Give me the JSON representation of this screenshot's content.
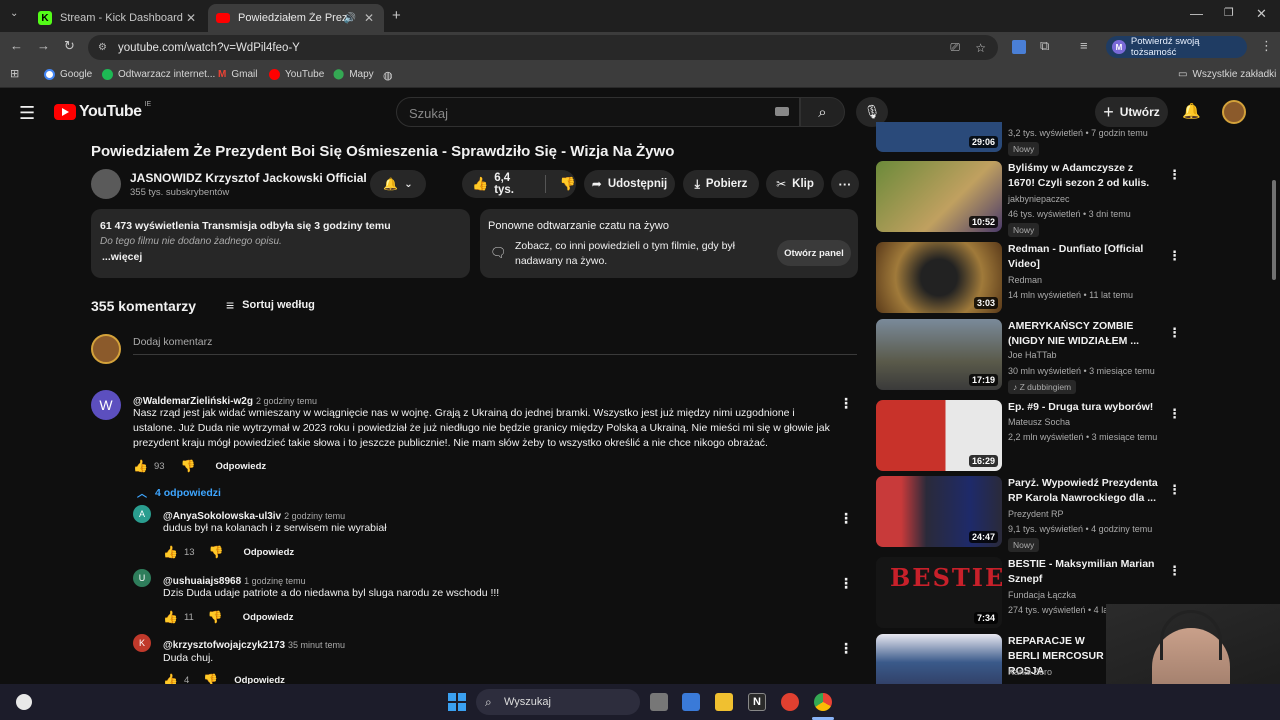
{
  "browser": {
    "tabs": [
      {
        "title": "Stream - Kick Dashboard",
        "favicon": "K"
      },
      {
        "title": "Powiedziałem Że Prezydent",
        "favicon": "yt"
      }
    ],
    "url": "youtube.com/watch?v=WdPil4feo-Y",
    "profile_label": "Potwierdź swoją tożsamość",
    "profile_initial": "M",
    "bookmarks": [
      "Google",
      "Odtwarzacz internet...",
      "Gmail",
      "YouTube",
      "Mapy"
    ],
    "all_bookmarks": "Wszystkie zakładki"
  },
  "youtube": {
    "logo_text": "YouTube",
    "region": "IE",
    "search_placeholder": "Szukaj",
    "create_label": "Utwórz",
    "video": {
      "title": "Powiedziałem Że Prezydent Boi Się Ośmieszenia - Sprawdziło Się - Wizja Na Żywo",
      "channel": "JASNOWIDZ Krzysztof Jackowski Official",
      "subscribers": "355 tys. subskrybentów",
      "likes": "6,4 tys.",
      "share": "Udostępnij",
      "download": "Pobierz",
      "clip": "Klip"
    },
    "description": {
      "stats": "61 473 wyświetlenia  Transmisja odbyła się 3 godziny temu",
      "text": "Do tego filmu nie dodano żadnego opisu.",
      "more": "...więcej"
    },
    "chat_replay": {
      "title": "Ponowne odtwarzanie czatu na żywo",
      "text": "Zobacz, co inni powiedzieli o tym filmie, gdy był nadawany na żywo.",
      "button": "Otwórz panel"
    },
    "comments": {
      "count": "355 komentarzy",
      "sort": "Sortuj według",
      "add_placeholder": "Dodaj komentarz",
      "reply_label": "Odpowiedz",
      "top": {
        "author": "@WaldemarZieliński-w2g",
        "time": "2 godziny temu",
        "initial": "W",
        "text": "Nasz rząd jest jak widać wmieszany w wciągnięcie nas w wojnę. Grają z Ukrainą do jednej bramki. Wszystko jest już między nimi uzgodnione i ustalone. Już Duda nie wytrzymał w 2023 roku i powiedział że już niedługo nie będzie granicy między Polską a Ukrainą. Nie mieści mi się w głowie jak prezydent kraju mógł powiedzieć takie słowa i to jeszcze publicznie!. Nie mam słów żeby to wszystko określić a nie chce nikogo obrażać.",
        "likes": "93",
        "replies_toggle": "4 odpowiedzi"
      },
      "replies": [
        {
          "author": "@AnyaSokolowska-ul3iv",
          "time": "2 godziny temu",
          "initial": "A",
          "color": "#2a9d8f",
          "text": "dudus był na kolanach i z serwisem nie wyrabiał",
          "likes": "13"
        },
        {
          "author": "@ushuaiajs8968",
          "time": "1 godzinę temu",
          "initial": "U",
          "color": "#2e7d5b",
          "text": "Dzis Duda udaje patriote a do niedawna byl sluga narodu ze wschodu !!!",
          "likes": "11"
        },
        {
          "author": "@krzysztofwojajczyk2173",
          "time": "35 minut temu",
          "initial": "K",
          "color": "#c0392b",
          "text": "Duda chuj.",
          "likes": "4"
        }
      ]
    },
    "sidebar": [
      {
        "title": "",
        "channel": "",
        "meta": "3,2 tys. wyświetleń • 7 godzin temu",
        "duration": "29:06",
        "badge": "Nowy",
        "thumb": "#2a4a7a"
      },
      {
        "title": "Byliśmy w Adamczysze z 1670! Czyli sezon 2 od kulis.",
        "channel": "jakbyniepaczec",
        "meta": "46 tys. wyświetleń • 3 dni temu",
        "duration": "10:52",
        "badge": "Nowy",
        "thumb": "#5a7a3a"
      },
      {
        "title": "Redman - Dunfiato [Official Video]",
        "channel": "Redman",
        "meta": "14 mln wyświetleń • 11 lat temu",
        "duration": "3:03",
        "badge": "",
        "thumb": "#7a5a2a"
      },
      {
        "title": "AMERYKAŃSCY ZOMBIE (NIGDY NIE WIDZIAŁEM ...",
        "channel": "Joe HaTTab",
        "meta": "30 mln wyświetleń • 3 miesiące temu",
        "duration": "17:19",
        "badge": "Z dubbingiem",
        "thumb": "#6a6a5a"
      },
      {
        "title": "Ep. #9 - Druga tura wyborów!",
        "channel": "Mateusz Socha",
        "meta": "2,2 mln wyświetleń • 3 miesiące temu",
        "duration": "16:29",
        "badge": "",
        "thumb": "#b8322a"
      },
      {
        "title": "Paryż. Wypowiedź Prezydenta RP Karola Nawrockiego dla ...",
        "channel": "Prezydent RP",
        "meta": "9,1 tys. wyświetleń • 4 godziny temu",
        "duration": "24:47",
        "badge": "Nowy",
        "thumb": "#3a3050"
      },
      {
        "title": "BESTIE - Maksymilian Marian Sznepf",
        "channel": "Fundacja Łączka",
        "meta": "274 tys. wyświetleń • 4 la",
        "duration": "7:34",
        "badge": "",
        "thumb": "#1a1a1a"
      },
      {
        "title": "REPARACJE W BERLI MERCOSUR I ROSJA",
        "channel": "Kanał Zero",
        "meta": "",
        "duration": "",
        "badge": "",
        "thumb": "#3a5a8a"
      }
    ]
  },
  "taskbar": {
    "search": "Wyszukaj"
  }
}
